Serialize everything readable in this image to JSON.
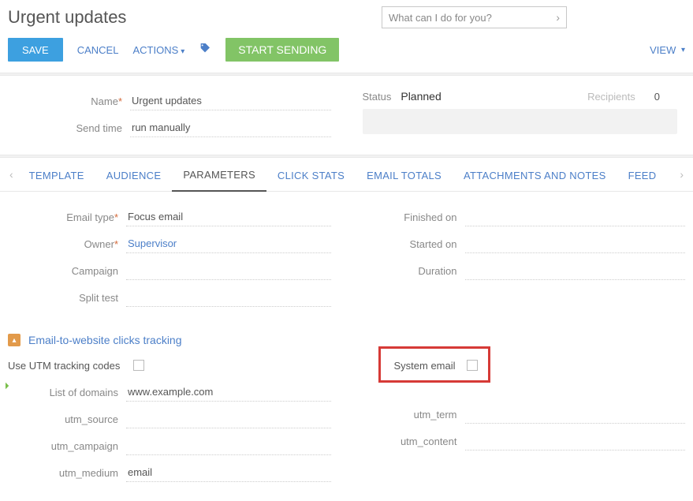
{
  "header": {
    "title": "Urgent updates",
    "search_placeholder": "What can I do for you?"
  },
  "toolbar": {
    "save": "SAVE",
    "cancel": "CANCEL",
    "actions": "ACTIONS",
    "start_sending": "START SENDING",
    "view": "VIEW"
  },
  "summary": {
    "name_label": "Name",
    "name_value": "Urgent updates",
    "sendtime_label": "Send time",
    "sendtime_value": "run manually",
    "status_label": "Status",
    "status_value": "Planned",
    "recipients_label": "Recipients",
    "recipients_value": "0"
  },
  "tabs": {
    "template": "TEMPLATE",
    "audience": "AUDIENCE",
    "parameters": "PARAMETERS",
    "click_stats": "CLICK STATS",
    "email_totals": "EMAIL TOTALS",
    "attachments": "ATTACHMENTS AND NOTES",
    "feed": "FEED"
  },
  "params": {
    "email_type_label": "Email type",
    "email_type_value": "Focus email",
    "owner_label": "Owner",
    "owner_value": "Supervisor",
    "campaign_label": "Campaign",
    "campaign_value": "",
    "split_label": "Split test",
    "split_value": "",
    "finished_label": "Finished on",
    "started_label": "Started on",
    "duration_label": "Duration"
  },
  "tracking": {
    "section_title": "Email-to-website clicks tracking",
    "utm_codes_label": "Use UTM tracking codes",
    "system_email_label": "System email",
    "domains_label": "List of domains",
    "domains_value": "www.example.com",
    "utm_source_label": "utm_source",
    "utm_source_value": "",
    "utm_campaign_label": "utm_campaign",
    "utm_campaign_value": "",
    "utm_medium_label": "utm_medium",
    "utm_medium_value": "email",
    "utm_term_label": "utm_term",
    "utm_term_value": "",
    "utm_content_label": "utm_content",
    "utm_content_value": ""
  }
}
